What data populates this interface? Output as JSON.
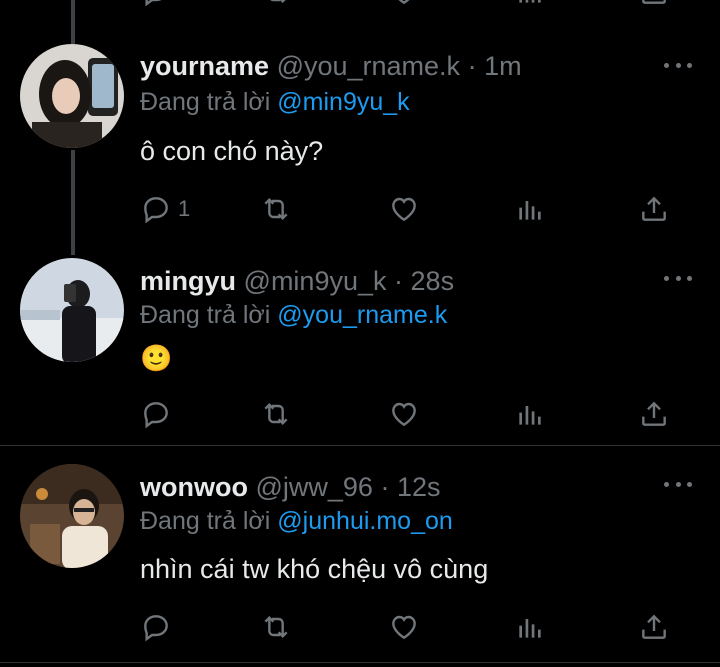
{
  "tweets": [
    {
      "name": "yourname",
      "handle": "@you_rname.k",
      "time": "1m",
      "reply_prefix": "Đang trả lời",
      "reply_to": "@min9yu_k",
      "text": "ô con chó này?",
      "reply_count": "1"
    },
    {
      "name": "mingyu",
      "handle": "@min9yu_k",
      "time": "28s",
      "reply_prefix": "Đang trả lời",
      "reply_to": "@you_rname.k",
      "text": "🙂",
      "reply_count": ""
    },
    {
      "name": "wonwoo",
      "handle": "@jww_96",
      "time": "12s",
      "reply_prefix": "Đang trả lời",
      "reply_to": "@junhui.mo_on",
      "text": "nhìn cái tw khó chệu vô cùng",
      "reply_count": ""
    }
  ],
  "separator": "·",
  "icons": [
    "reply-icon",
    "retweet-icon",
    "like-icon",
    "views-icon",
    "share-icon",
    "more-icon"
  ],
  "colors": {
    "background": "#000000",
    "text": "#e7e9ea",
    "muted": "#71767b",
    "link": "#1d9bf0"
  }
}
